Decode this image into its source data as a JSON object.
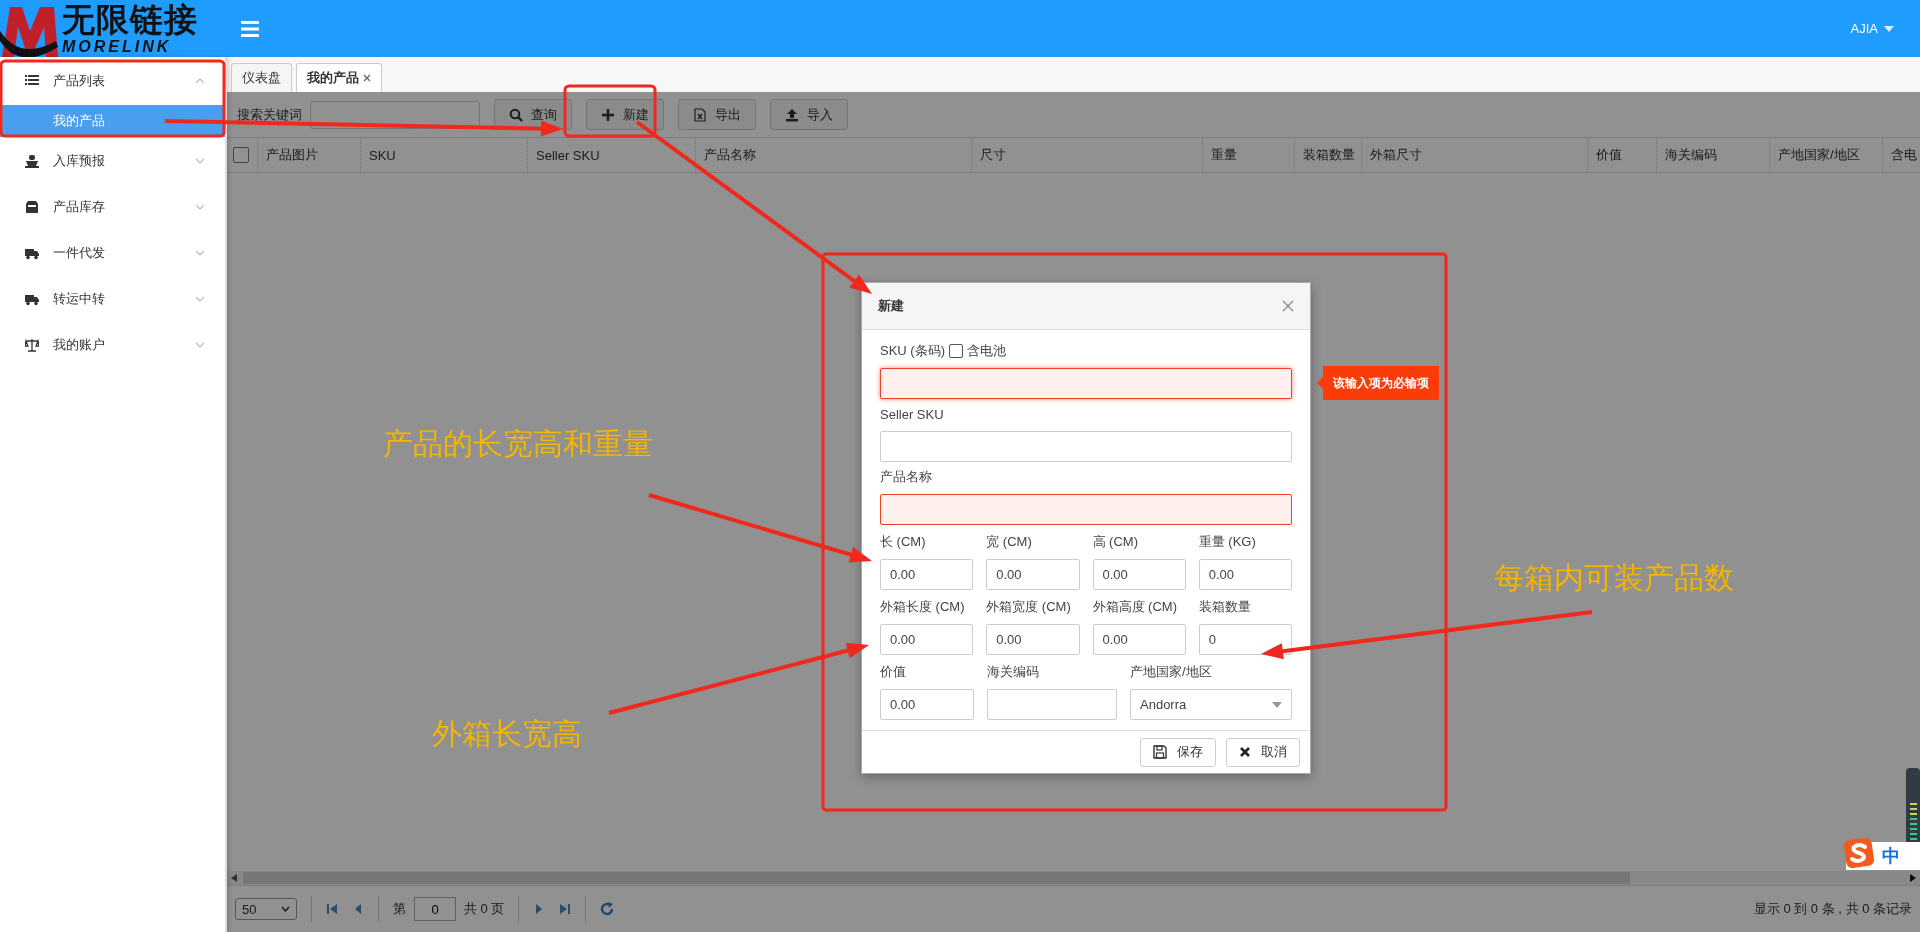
{
  "header": {
    "logo_cn": "无限链接",
    "logo_en": "MORELINK",
    "user": "AJIA"
  },
  "sidebar": {
    "items": [
      {
        "label": "产品列表",
        "expanded": true,
        "children": [
          {
            "label": "我的产品",
            "selected": true
          }
        ]
      },
      {
        "label": "入库预报",
        "expanded": false
      },
      {
        "label": "产品库存",
        "expanded": false
      },
      {
        "label": "一件代发",
        "expanded": false
      },
      {
        "label": "转运中转",
        "expanded": false
      },
      {
        "label": "我的账户",
        "expanded": false
      }
    ]
  },
  "tabs": [
    {
      "label": "仪表盘",
      "selected": false,
      "closable": false
    },
    {
      "label": "我的产品",
      "selected": true,
      "closable": true
    }
  ],
  "toolbar": {
    "search_label": "搜索关键词",
    "buttons": [
      {
        "label": "查询"
      },
      {
        "label": "新建"
      },
      {
        "label": "导出"
      },
      {
        "label": "导入"
      }
    ]
  },
  "table": {
    "select_all_checked": false,
    "columns": [
      "产品图片",
      "SKU",
      "Seller SKU",
      "产品名称",
      "尺寸",
      "重量",
      "装箱数量",
      "外箱尺寸",
      "价值",
      "海关编码",
      "产地国家/地区",
      "含电"
    ]
  },
  "pager": {
    "page_size": "50",
    "page_label": "第",
    "page": "0",
    "total_pages": "共 0 页",
    "summary": "显示 0 到 0 条 , 共 0 条记录"
  },
  "dialog": {
    "title": "新建",
    "sku": {
      "label": "SKU (条码)",
      "checkbox_label": "含电池",
      "checked": false,
      "invalid": true,
      "error": "该输入项为必输项"
    },
    "text_fields": [
      {
        "label": "Seller SKU",
        "invalid": false
      },
      {
        "label": "产品名称",
        "invalid": true
      }
    ],
    "grid_rows": [
      [
        {
          "kind": "input",
          "label": "长 (CM)",
          "value": "0.00"
        },
        {
          "kind": "input",
          "label": "宽 (CM)",
          "value": "0.00"
        },
        {
          "kind": "input",
          "label": "高 (CM)",
          "value": "0.00"
        },
        {
          "kind": "input",
          "label": "重量 (KG)",
          "value": "0.00"
        }
      ],
      [
        {
          "kind": "input",
          "label": "外箱长度 (CM)",
          "value": "0.00"
        },
        {
          "kind": "input",
          "label": "外箱宽度 (CM)",
          "value": "0.00"
        },
        {
          "kind": "input",
          "label": "外箱高度 (CM)",
          "value": "0.00"
        },
        {
          "kind": "input",
          "label": "装箱数量",
          "value": "0"
        }
      ],
      [
        {
          "kind": "input",
          "label": "价值",
          "value": "0.00"
        },
        {
          "kind": "input",
          "label": "海关编码"
        },
        {
          "kind": "select",
          "label": "产地国家/地区",
          "value": "Andorra"
        }
      ]
    ],
    "buttons": [
      {
        "label": "保存"
      },
      {
        "label": "取消"
      }
    ]
  },
  "annotations": [
    {
      "text": "产品的长宽高和重量"
    },
    {
      "text": "外箱长宽高"
    },
    {
      "text": "每箱内可装产品数"
    }
  ],
  "ime": {
    "mode": "中"
  }
}
